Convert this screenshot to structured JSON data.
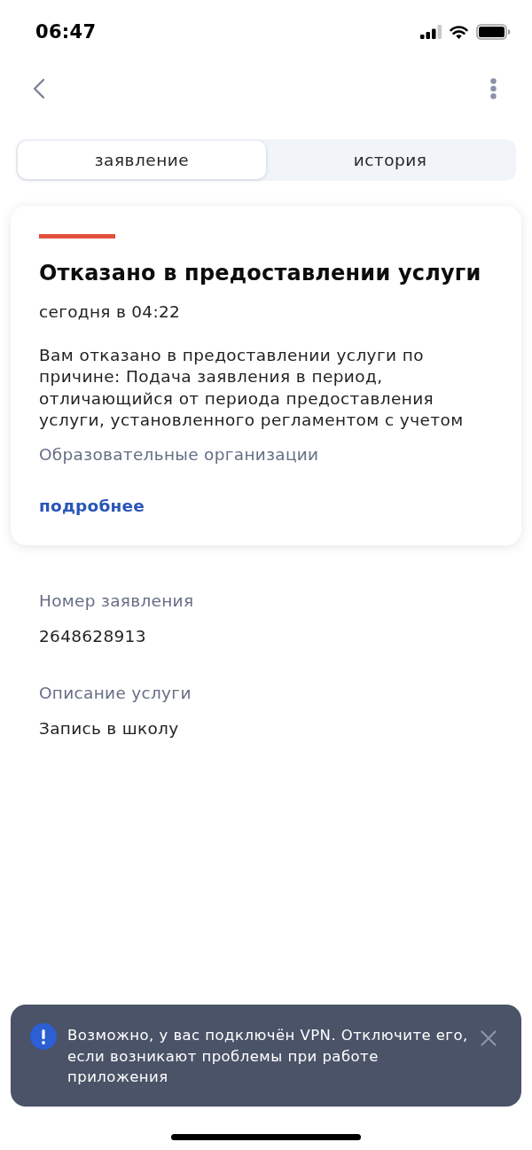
{
  "status_bar": {
    "time": "06:47"
  },
  "tabs": [
    {
      "label": "заявление",
      "selected": true
    },
    {
      "label": "история",
      "selected": false
    }
  ],
  "status_card": {
    "kind": "rejected",
    "title": "Отказано в предоставлении услуги",
    "date": "сегодня в 04:22",
    "message": "Вам отказано в предоставлении услуги по причине: Подача заявления в период, отличающийся от периода предоставления услуги, установленного регламентом с учетом",
    "department": "Образовательные организации",
    "link": "подробнее"
  },
  "details": [
    {
      "label": "Номер заявления",
      "value": "2648628913"
    },
    {
      "label": "Описание услуги",
      "value": "Запись в школу"
    }
  ],
  "toast": {
    "message": "Возможно, у вас подключён VPN. Отключите его, если возникают проблемы при работе приложения"
  }
}
